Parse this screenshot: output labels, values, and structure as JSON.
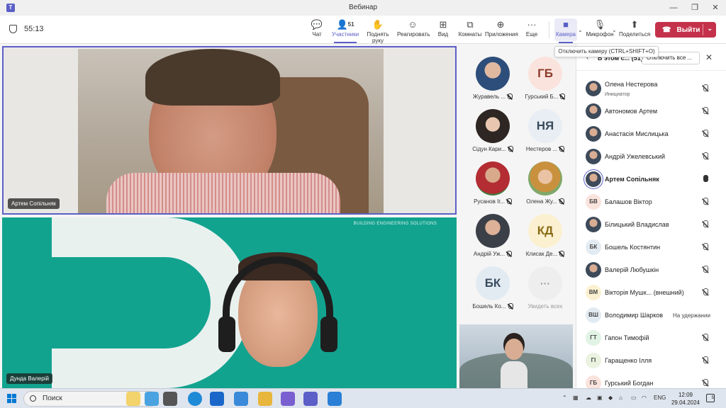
{
  "window": {
    "title": "Вебинар",
    "minimize": "—",
    "restore": "❐",
    "close": "✕"
  },
  "toolbar": {
    "timer": "55:13",
    "chat": "Чат",
    "participants": "Участники",
    "participants_count": "51",
    "raise_hand": "Поднять руку",
    "react": "Реагировать",
    "view": "Вид",
    "rooms": "Комнаты",
    "apps": "Приложения",
    "more": "Еще",
    "camera": "Камера",
    "microphone": "Микрофон",
    "share": "Поделиться",
    "leave": "Выйти"
  },
  "tooltip": "Отключить камеру (CTRL+SHIFT+O)",
  "videos": {
    "main_top": "Артем Сопільняк",
    "main_bottom": "Дунда Валерій",
    "bottom_brand": "BUILDING ENGINEERING SOLUTIONS"
  },
  "gallery": [
    {
      "initials": "",
      "name": "Журавель ...",
      "style": "av-photo1"
    },
    {
      "initials": "ГБ",
      "name": "Гурський Б...",
      "style": "av-gb"
    },
    {
      "initials": "",
      "name": "Сідун Кари...",
      "style": "av-photo2"
    },
    {
      "initials": "НЯ",
      "name": "Нестеров ...",
      "style": "av-ny"
    },
    {
      "initials": "",
      "name": "Русанов Іг...",
      "style": "av-photo3"
    },
    {
      "initials": "",
      "name": "Олена Жу...",
      "style": "av-photo4"
    },
    {
      "initials": "",
      "name": "Андрій Уж...",
      "style": "av-photo5"
    },
    {
      "initials": "КД",
      "name": "Клисак Де...",
      "style": "av-kd"
    },
    {
      "initials": "БК",
      "name": "Бошель Ко...",
      "style": "av-bk"
    },
    {
      "initials": "···",
      "name": "Увидеть всех",
      "style": "av-more"
    }
  ],
  "panel": {
    "title": "В этом с... (51)",
    "mute_all": "Отключить все ...",
    "participants": [
      {
        "initials": "",
        "name": "Олена Нестерова",
        "role": "Инициатор",
        "status": "",
        "mic": "muted",
        "style": "c-photo"
      },
      {
        "initials": "",
        "name": "Автономов Артем",
        "role": "",
        "status": "",
        "mic": "muted",
        "style": "c-photo"
      },
      {
        "initials": "",
        "name": "Анастасія Мислицька",
        "role": "",
        "status": "",
        "mic": "muted",
        "style": "c-photo"
      },
      {
        "initials": "",
        "name": "Андрій Ужелевський",
        "role": "",
        "status": "",
        "mic": "muted",
        "style": "c-photo"
      },
      {
        "initials": "",
        "name": "Артем Сопільняк",
        "role": "",
        "status": "",
        "mic": "on",
        "style": "c-photo"
      },
      {
        "initials": "БВ",
        "name": "Балашов Віктор",
        "role": "",
        "status": "",
        "mic": "muted",
        "style": "c-bv"
      },
      {
        "initials": "",
        "name": "Білицький Владислав",
        "role": "",
        "status": "",
        "mic": "muted",
        "style": "c-photo"
      },
      {
        "initials": "БК",
        "name": "Бошель Костянтин",
        "role": "",
        "status": "",
        "mic": "muted",
        "style": "c-bk"
      },
      {
        "initials": "",
        "name": "Валерій Любушкін",
        "role": "",
        "status": "",
        "mic": "muted",
        "style": "c-photo"
      },
      {
        "initials": "ВМ",
        "name": "Вікторія Мушк... (внешний)",
        "role": "",
        "status": "",
        "mic": "muted",
        "style": "c-vm"
      },
      {
        "initials": "ВШ",
        "name": "Володимир Шарков",
        "role": "",
        "status": "На удержании",
        "mic": "none",
        "style": "c-vs"
      },
      {
        "initials": "ГТ",
        "name": "Гапон Тимофій",
        "role": "",
        "status": "",
        "mic": "muted",
        "style": "c-gt"
      },
      {
        "initials": "ГІ",
        "name": "Гаращенко Ілля",
        "role": "",
        "status": "",
        "mic": "muted",
        "style": "c-gi"
      },
      {
        "initials": "ГБ",
        "name": "Гурський Богдан",
        "role": "",
        "status": "",
        "mic": "muted",
        "style": "c-gb"
      }
    ]
  },
  "taskbar": {
    "search_placeholder": "Поиск",
    "lang": "ENG",
    "time": "12:09",
    "date": "29.04.2024",
    "notif_count": "5"
  },
  "colors": {
    "accent": "#5b5fc7",
    "leave": "#c4314b"
  }
}
